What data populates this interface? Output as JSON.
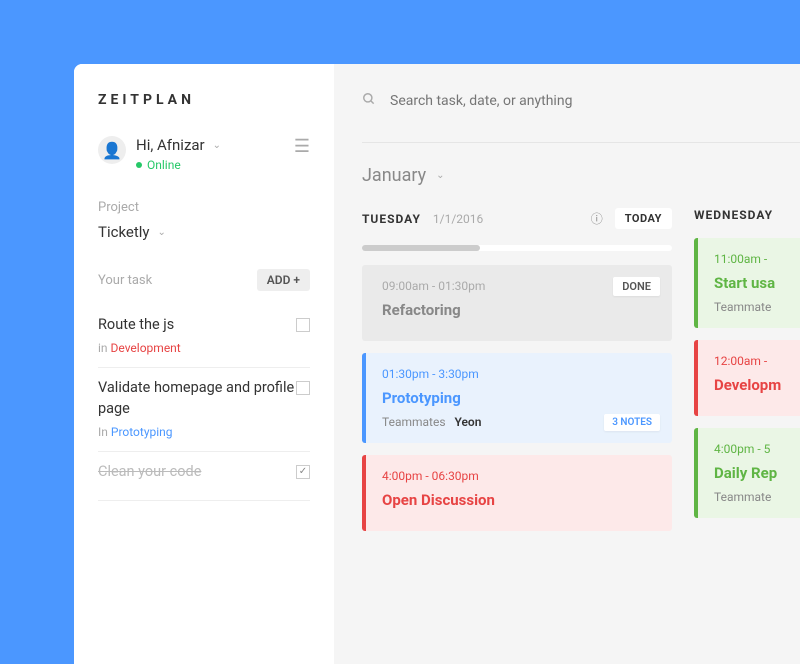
{
  "brand": "ZEITPLAN",
  "user": {
    "greeting": "Hi, Afnizar",
    "status": "Online"
  },
  "project": {
    "label": "Project",
    "name": "Ticketly"
  },
  "tasks": {
    "label": "Your task",
    "add": "ADD +",
    "items": [
      {
        "title": "Route the js",
        "meta_prefix": "in ",
        "meta_tag": "Development",
        "tag_class": "in-dev",
        "done": false
      },
      {
        "title": "Validate homepage and profile page",
        "meta_prefix": "In ",
        "meta_tag": "Prototyping",
        "tag_class": "in-proto",
        "done": false
      },
      {
        "title": "Clean your code",
        "meta_prefix": "",
        "meta_tag": "",
        "tag_class": "",
        "done": true
      }
    ]
  },
  "search": {
    "placeholder": "Search task, date, or anything"
  },
  "month": "January",
  "today_label": "TODAY",
  "columns": [
    {
      "day": "TUESDAY",
      "date": "1/1/2016",
      "show_today": true,
      "events": [
        {
          "time": "09:00am - 01:30pm",
          "title": "Refactoring",
          "team_label": "",
          "team_value": "",
          "card": "card-gray",
          "done": "DONE",
          "notes": ""
        },
        {
          "time": "01:30pm - 3:30pm",
          "title": "Prototyping",
          "team_label": "Teammates",
          "team_value": "Yeon",
          "card": "card-blue",
          "done": "",
          "notes": "3 NOTES"
        },
        {
          "time": "4:00pm - 06:30pm",
          "title": "Open Discussion",
          "team_label": "",
          "team_value": "",
          "card": "card-red",
          "done": "",
          "notes": ""
        }
      ]
    },
    {
      "day": "WEDNESDAY",
      "date": "",
      "show_today": false,
      "events": [
        {
          "time": "11:00am - ",
          "title": "Start usa",
          "team_label": "Teammate",
          "team_value": "",
          "card": "card-green",
          "done": "",
          "notes": ""
        },
        {
          "time": "12:00am - ",
          "title": "Developm",
          "team_label": "",
          "team_value": "",
          "card": "card-red",
          "done": "",
          "notes": ""
        },
        {
          "time": "4:00pm - 5",
          "title": "Daily Rep",
          "team_label": "Teammate",
          "team_value": "",
          "card": "card-green",
          "done": "",
          "notes": ""
        }
      ]
    }
  ]
}
